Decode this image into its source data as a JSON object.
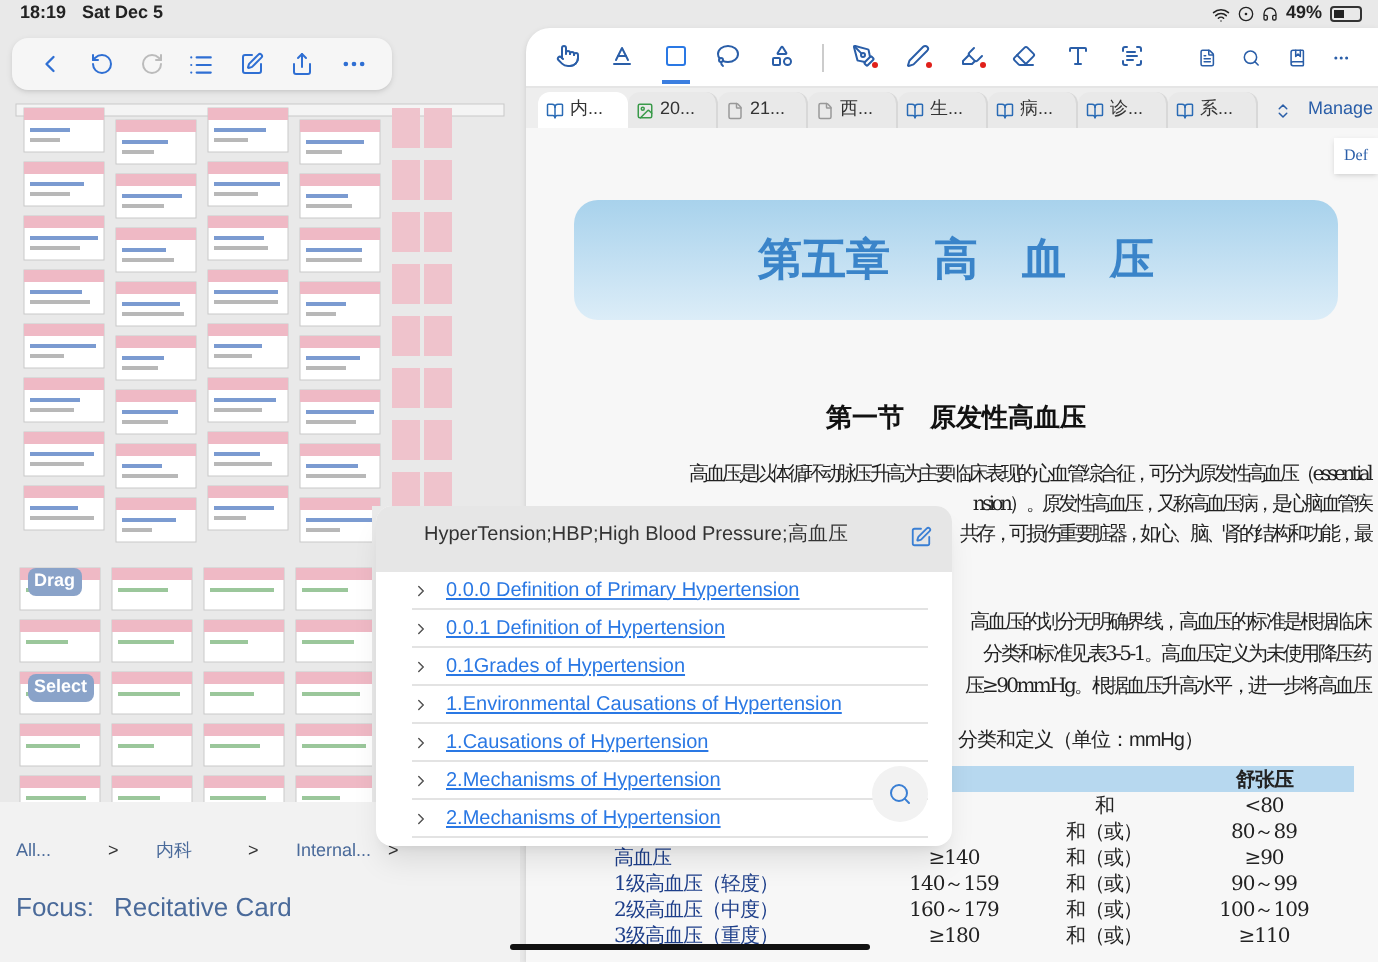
{
  "status_bar": {
    "time": "18:19",
    "date": "Sat Dec 5",
    "battery": "49%"
  },
  "mind_map": {
    "labels": [
      "Drag",
      "Select"
    ],
    "breadcrumb": [
      {
        "label": "All...",
        "separator": ">"
      },
      {
        "label": "内科",
        "separator": ">"
      },
      {
        "label": "Internal...",
        "separator": ">"
      }
    ],
    "focus": {
      "label": "Focus:",
      "value": "Recitative Card"
    }
  },
  "reader": {
    "tools": [
      {
        "kind": "hand",
        "selected": false
      },
      {
        "kind": "text",
        "selected": false
      },
      {
        "kind": "rectangle",
        "selected": true
      },
      {
        "kind": "lasso",
        "selected": false
      },
      {
        "kind": "shapes",
        "selected": false
      },
      {
        "kind": "pen",
        "selected": false
      },
      {
        "kind": "marker",
        "selected": false
      },
      {
        "kind": "highlighter",
        "selected": false
      },
      {
        "kind": "eraser",
        "selected": false
      },
      {
        "kind": "textbox",
        "selected": false
      },
      {
        "kind": "selection",
        "selected": false
      }
    ],
    "tabs": [
      {
        "label": "内...",
        "kind": "book",
        "selected": true
      },
      {
        "label": "20...",
        "kind": "image",
        "selected": false
      },
      {
        "label": "21...",
        "kind": "document",
        "selected": false
      },
      {
        "label": "西...",
        "kind": "document",
        "selected": false
      },
      {
        "label": "生...",
        "kind": "book",
        "selected": false
      },
      {
        "label": "病...",
        "kind": "book",
        "selected": false
      },
      {
        "label": "诊...",
        "kind": "book",
        "selected": false
      },
      {
        "label": "系...",
        "kind": "book",
        "selected": false
      }
    ],
    "manage": "Manage",
    "def_button": "Def",
    "document": {
      "chapter": "第五章　高　血　压",
      "section": "第一节　原发性高血压",
      "paragraph_lines": [
        "高血压是以体循环动脉压升高为主要临床表现的心血管综合征，可分为原发性高血压（essential",
        "nsion）。原发性高血压，又称高血压病，是心脑血管疾",
        "共存，可损伤重要脏器，如心、脑、肾的结构和功能，最"
      ],
      "paragraph2_lines": [
        "高血压的划分无明确界线，高血压的标准是根据临床",
        "分类和标准见表3-5-1。高血压定义为未使用降压药",
        "压≥90mmHg。根据血压升高水平，进一步将高血压"
      ],
      "table_caption": "分类和定义（单位：mmHg）",
      "table_header": "舒张压",
      "table_rows": [
        {
          "connector": "和",
          "diastolic": "<80"
        },
        {
          "connector": "和（或）",
          "diastolic": "80～89"
        },
        {
          "category": "高血压",
          "systolic": "≥140",
          "connector": "和（或）",
          "diastolic": "≥90"
        },
        {
          "category": "1级高血压（轻度）",
          "systolic": "140～159",
          "connector": "和（或）",
          "diastolic": "90～99"
        },
        {
          "category": "2级高血压（中度）",
          "systolic": "160～179",
          "connector": "和（或）",
          "diastolic": "100～109"
        },
        {
          "category": "3级高血压（重度）",
          "systolic": "≥180",
          "connector": "和（或）",
          "diastolic": "≥110"
        }
      ]
    }
  },
  "popup": {
    "title": "HyperTension;HBP;High Blood Pressure;高血压",
    "links": [
      "0.0.0 Definition of Primary Hypertension",
      "0.0.1 Definition of Hypertension",
      "0.1Grades of Hypertension",
      "1.Environmental Causations of Hypertension",
      "1.Causations of Hypertension",
      "2.Mechanisms of Hypertension",
      "2.Mechanisms of Hypertension"
    ]
  }
}
